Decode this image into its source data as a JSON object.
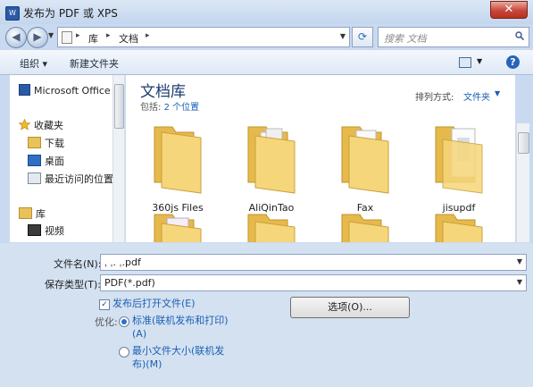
{
  "window": {
    "title": "发布为 PDF 或 XPS",
    "close_glyph": "✕"
  },
  "address": {
    "breadcrumbs": [
      "库",
      "文档"
    ],
    "sep": "▸",
    "search_placeholder": "搜索 文档"
  },
  "toolbar": {
    "organize": "组织 ▾",
    "new_folder": "新建文件夹",
    "help": "?"
  },
  "nav": {
    "items": [
      {
        "label": "Microsoft Office W",
        "icon": "word-icon"
      },
      {
        "label": "收藏夹",
        "icon": "star-icon"
      },
      {
        "label": "下载",
        "icon": "download-folder-icon"
      },
      {
        "label": "桌面",
        "icon": "desktop-icon"
      },
      {
        "label": "最近访问的位置",
        "icon": "recent-icon"
      },
      {
        "label": "库",
        "icon": "library-icon"
      },
      {
        "label": "视频",
        "icon": "video-icon"
      }
    ]
  },
  "content": {
    "library_title": "文档库",
    "includes_label": "包括:",
    "includes_link": "2 个位置",
    "sort_label": "排列方式:",
    "sort_value": "文件夹",
    "folders": [
      "360js Files",
      "AliQinTao",
      "Fax",
      "jisupdf"
    ]
  },
  "form": {
    "filename_label": "文件名(N):",
    "filename_value": "ˌ     ˌ. ˌ.pdf",
    "filetype_label": "保存类型(T):",
    "filetype_value": "PDF(*.pdf)",
    "open_after_label": "发布后打开文件(E)",
    "open_after_checked": true,
    "optimize_label": "优化:",
    "opt1_line1": "标准(联机发布和打印)",
    "opt1_line2": "(A)",
    "opt2_line1": "最小文件大小(联机发",
    "opt2_line2": "布)(M)",
    "options_button": "选项(O)..."
  },
  "colors": {
    "accent": "#1a5fb4",
    "folder": "#f3cf6a",
    "frame": "#c9daf0"
  }
}
